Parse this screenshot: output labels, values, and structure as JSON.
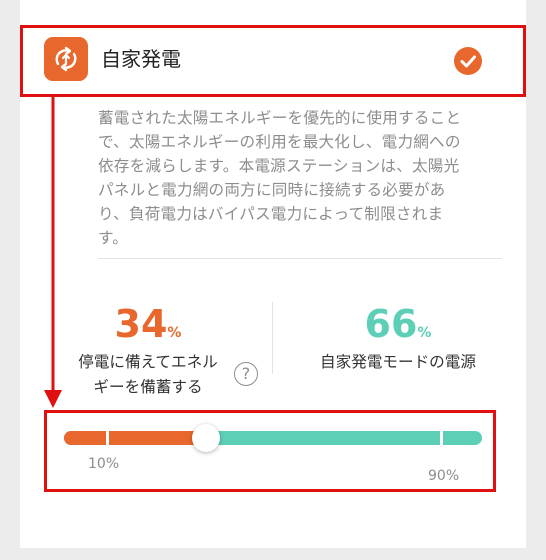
{
  "mode": {
    "title": "自家発電",
    "icon": "sync-arrows-icon",
    "selected": true,
    "selected_icon": "check-circle-icon",
    "description": [
      "蓄電された太陽エネルギーを優先的に使用すること",
      "で、太陽エネルギーの利用を最大化し、電力網への",
      "依存を減らします。本電源ステーションは、太陽光",
      "パネルと電力網の両方に同時に接続する必要があ",
      "り、負荷電力はバイパス電力によって制限されま",
      "す。"
    ]
  },
  "stats": {
    "backup": {
      "value": "34",
      "unit": "%",
      "label_lines": [
        "停電に備えてエネル",
        "ギーを備蓄する"
      ],
      "help_icon": "question-circle-icon",
      "help_glyph": "?"
    },
    "self_powered": {
      "value": "66",
      "unit": "%",
      "label": "自家発電モードの電源"
    }
  },
  "slider": {
    "value_fraction": 0.34,
    "min_label": "10%",
    "max_label": "90%",
    "min_fraction": 0.1,
    "max_fraction": 0.9
  },
  "colors": {
    "accent": "#e8672c",
    "secondary": "#5dcfb6",
    "annotation": "#e01010"
  }
}
